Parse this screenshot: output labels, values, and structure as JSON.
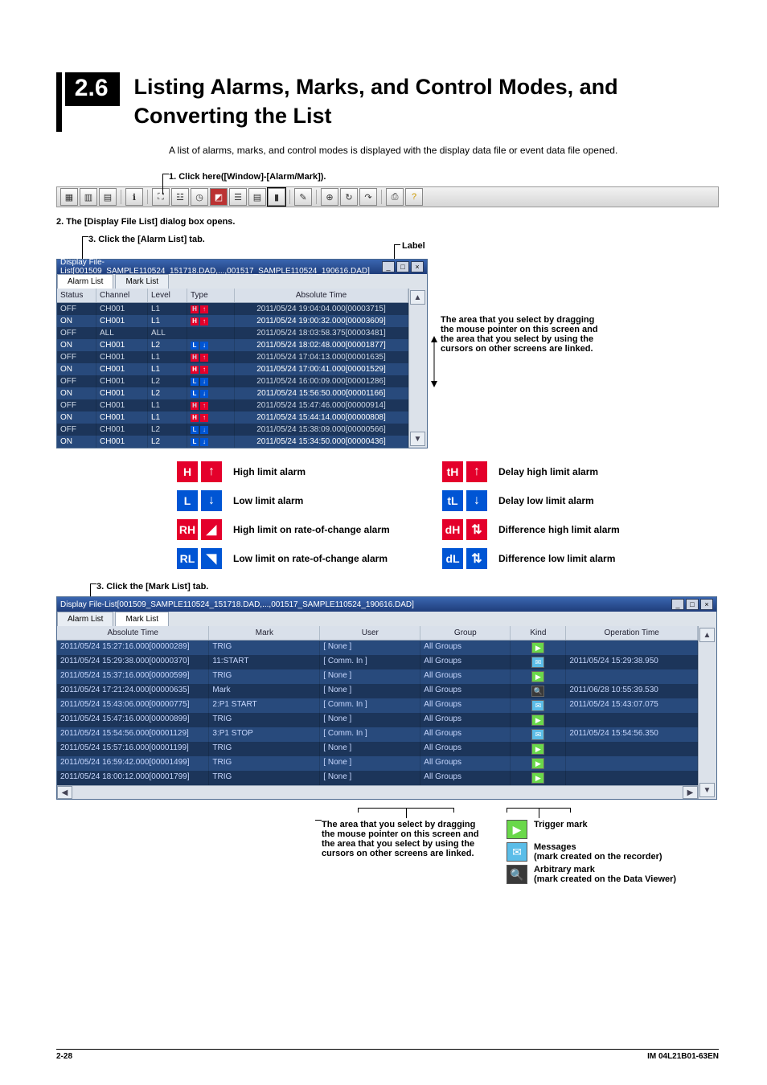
{
  "section_number": "2.6",
  "section_title": "Listing Alarms, Marks, and Control Modes, and Converting the List",
  "intro": "A list of alarms, marks, and control modes is displayed with the display data file or event data file opened.",
  "step1": "1. Click here([Window]-[Alarm/Mark]).",
  "step2": "2. The [Display File List] dialog box opens.",
  "step3a": "3. Click the [Alarm List] tab.",
  "step3b": "3. Click the [Mark List] tab.",
  "label_callout": "Label",
  "drag_note_top": "The area that you select by dragging the mouse pointer on this screen and the area that you select by using the cursors on other screens are linked.",
  "drag_note_bottom": "The area that you select by dragging the mouse pointer on this screen and the area that you select by using the cursors on other screens are linked.",
  "win1_title": "Display File-List[001509_SAMPLE110524_151718.DAD,...,001517_SAMPLE110524_190616.DAD]",
  "win2_title": "Display File-List[001509_SAMPLE110524_151718.DAD,...,001517_SAMPLE110524_190616.DAD]",
  "tab_alarm": "Alarm List",
  "tab_mark": "Mark List",
  "alarm_headers": {
    "status": "Status",
    "channel": "Channel",
    "level": "Level",
    "type": "Type",
    "abs": "Absolute Time"
  },
  "alarm_rows": [
    {
      "st": "OFF",
      "ch": "CH001",
      "lv": "L1",
      "ty": "H",
      "time": "2011/05/24 19:04:04.000[00003715]"
    },
    {
      "st": "ON",
      "ch": "CH001",
      "lv": "L1",
      "ty": "H",
      "time": "2011/05/24 19:00:32.000[00003609]"
    },
    {
      "st": "OFF",
      "ch": "ALL",
      "lv": "ALL",
      "ty": "",
      "time": "2011/05/24 18:03:58.375[00003481]"
    },
    {
      "st": "ON",
      "ch": "CH001",
      "lv": "L2",
      "ty": "L",
      "time": "2011/05/24 18:02:48.000[00001877]"
    },
    {
      "st": "OFF",
      "ch": "CH001",
      "lv": "L1",
      "ty": "H",
      "time": "2011/05/24 17:04:13.000[00001635]"
    },
    {
      "st": "ON",
      "ch": "CH001",
      "lv": "L1",
      "ty": "H",
      "time": "2011/05/24 17:00:41.000[00001529]"
    },
    {
      "st": "OFF",
      "ch": "CH001",
      "lv": "L2",
      "ty": "L",
      "time": "2011/05/24 16:00:09.000[00001286]"
    },
    {
      "st": "ON",
      "ch": "CH001",
      "lv": "L2",
      "ty": "L",
      "time": "2011/05/24 15:56:50.000[00001166]"
    },
    {
      "st": "OFF",
      "ch": "CH001",
      "lv": "L1",
      "ty": "H",
      "time": "2011/05/24 15:47:46.000[00000914]"
    },
    {
      "st": "ON",
      "ch": "CH001",
      "lv": "L1",
      "ty": "H",
      "time": "2011/05/24 15:44:14.000[00000808]"
    },
    {
      "st": "OFF",
      "ch": "CH001",
      "lv": "L2",
      "ty": "L",
      "time": "2011/05/24 15:38:09.000[00000566]"
    },
    {
      "st": "ON",
      "ch": "CH001",
      "lv": "L2",
      "ty": "L",
      "time": "2011/05/24 15:34:50.000[00000436]"
    }
  ],
  "icon_legend": [
    {
      "sym": "H",
      "sym_bg": "bg-red",
      "arr": "↑",
      "arr_bg": "bg-red",
      "txt": "High limit alarm",
      "sym2": "tH",
      "sym2_bg": "bg-red",
      "arr2": "↑",
      "arr2_bg": "bg-red",
      "txt2": "Delay high limit alarm"
    },
    {
      "sym": "L",
      "sym_bg": "bg-blue",
      "arr": "↓",
      "arr_bg": "bg-blue",
      "txt": "Low limit alarm",
      "sym2": "tL",
      "sym2_bg": "bg-blue",
      "arr2": "↓",
      "arr2_bg": "bg-blue",
      "txt2": "Delay low limit alarm"
    },
    {
      "sym": "RH",
      "sym_bg": "bg-red",
      "arr": "◢",
      "arr_bg": "bg-red",
      "txt": "High limit on rate-of-change alarm",
      "sym2": "dH",
      "sym2_bg": "bg-red",
      "arr2": "⇅",
      "arr2_bg": "bg-red",
      "txt2": "Difference high limit alarm"
    },
    {
      "sym": "RL",
      "sym_bg": "bg-blue",
      "arr": "◥",
      "arr_bg": "bg-blue",
      "txt": "Low limit on rate-of-change alarm",
      "sym2": "dL",
      "sym2_bg": "bg-blue",
      "arr2": "⇅",
      "arr2_bg": "bg-blue",
      "txt2": "Difference low limit alarm"
    }
  ],
  "mark_headers": {
    "abs": "Absolute Time",
    "mark": "Mark",
    "user": "User",
    "group": "Group",
    "kind": "Kind",
    "op": "Operation Time"
  },
  "mark_rows": [
    {
      "abs": "2011/05/24 15:27:16.000[00000289]",
      "mk": "TRIG",
      "us": "[ None ]",
      "gp": "All Groups",
      "kd": "T",
      "op": ""
    },
    {
      "abs": "2011/05/24 15:29:38.000[00000370]",
      "mk": "11:START",
      "us": "[ Comm. In ]",
      "gp": "All Groups",
      "kd": "M",
      "op": "2011/05/24 15:29:38.950"
    },
    {
      "abs": "2011/05/24 15:37:16.000[00000599]",
      "mk": "TRIG",
      "us": "[ None ]",
      "gp": "All Groups",
      "kd": "T",
      "op": ""
    },
    {
      "abs": "2011/05/24 17:21:24.000[00000635]",
      "mk": "Mark",
      "us": "[ None ]",
      "gp": "All Groups",
      "kd": "A",
      "op": "2011/06/28 10:55:39.530"
    },
    {
      "abs": "2011/05/24 15:43:06.000[00000775]",
      "mk": "2:P1 START",
      "us": "[ Comm. In ]",
      "gp": "All Groups",
      "kd": "M",
      "op": "2011/05/24 15:43:07.075"
    },
    {
      "abs": "2011/05/24 15:47:16.000[00000899]",
      "mk": "TRIG",
      "us": "[ None ]",
      "gp": "All Groups",
      "kd": "T",
      "op": ""
    },
    {
      "abs": "2011/05/24 15:54:56.000[00001129]",
      "mk": "3:P1 STOP",
      "us": "[ Comm. In ]",
      "gp": "All Groups",
      "kd": "M",
      "op": "2011/05/24 15:54:56.350"
    },
    {
      "abs": "2011/05/24 15:57:16.000[00001199]",
      "mk": "TRIG",
      "us": "[ None ]",
      "gp": "All Groups",
      "kd": "T",
      "op": ""
    },
    {
      "abs": "2011/05/24 16:59:42.000[00001499]",
      "mk": "TRIG",
      "us": "[ None ]",
      "gp": "All Groups",
      "kd": "T",
      "op": ""
    },
    {
      "abs": "2011/05/24 18:00:12.000[00001799]",
      "mk": "TRIG",
      "us": "[ None ]",
      "gp": "All Groups",
      "kd": "T",
      "op": ""
    }
  ],
  "kind_legend": [
    {
      "ico": "▶",
      "bg": "#6ad84a",
      "title": "Trigger mark",
      "sub": ""
    },
    {
      "ico": "✉",
      "bg": "#5bbde8",
      "title": "Messages",
      "sub": "(mark created on the recorder)"
    },
    {
      "ico": "🔍",
      "bg": "#3a3a3a",
      "title": "Arbitrary mark",
      "sub": "(mark created on the Data Viewer)"
    }
  ],
  "footer": {
    "page": "2-28",
    "doc": "IM 04L21B01-63EN"
  }
}
